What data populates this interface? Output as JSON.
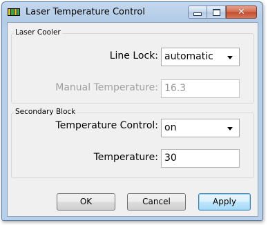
{
  "window": {
    "title": "Laser Temperature Control",
    "icon": "laser-app-icon",
    "controls": [
      "minimize-icon",
      "maximize-icon",
      "close-icon"
    ]
  },
  "laser_cooler": {
    "group_title": "Laser Cooler",
    "line_lock_label": "Line Lock:",
    "line_lock_value": "automatic",
    "manual_temp_label": "Manual Temperature:",
    "manual_temp_value": "16.3"
  },
  "secondary_block": {
    "group_title": "Secondary Block",
    "temp_control_label": "Temperature Control:",
    "temp_control_value": "on",
    "temperature_label": "Temperature:",
    "temperature_value": "30"
  },
  "buttons": {
    "ok": "OK",
    "cancel": "Cancel",
    "apply": "Apply"
  },
  "colors": {
    "titlebar": "#b2cbe6",
    "close_button": "#c4492c",
    "dialog_background": "#f0f0f0",
    "disabled_text": "#a0a0a0",
    "default_button": "#bee6fd"
  }
}
